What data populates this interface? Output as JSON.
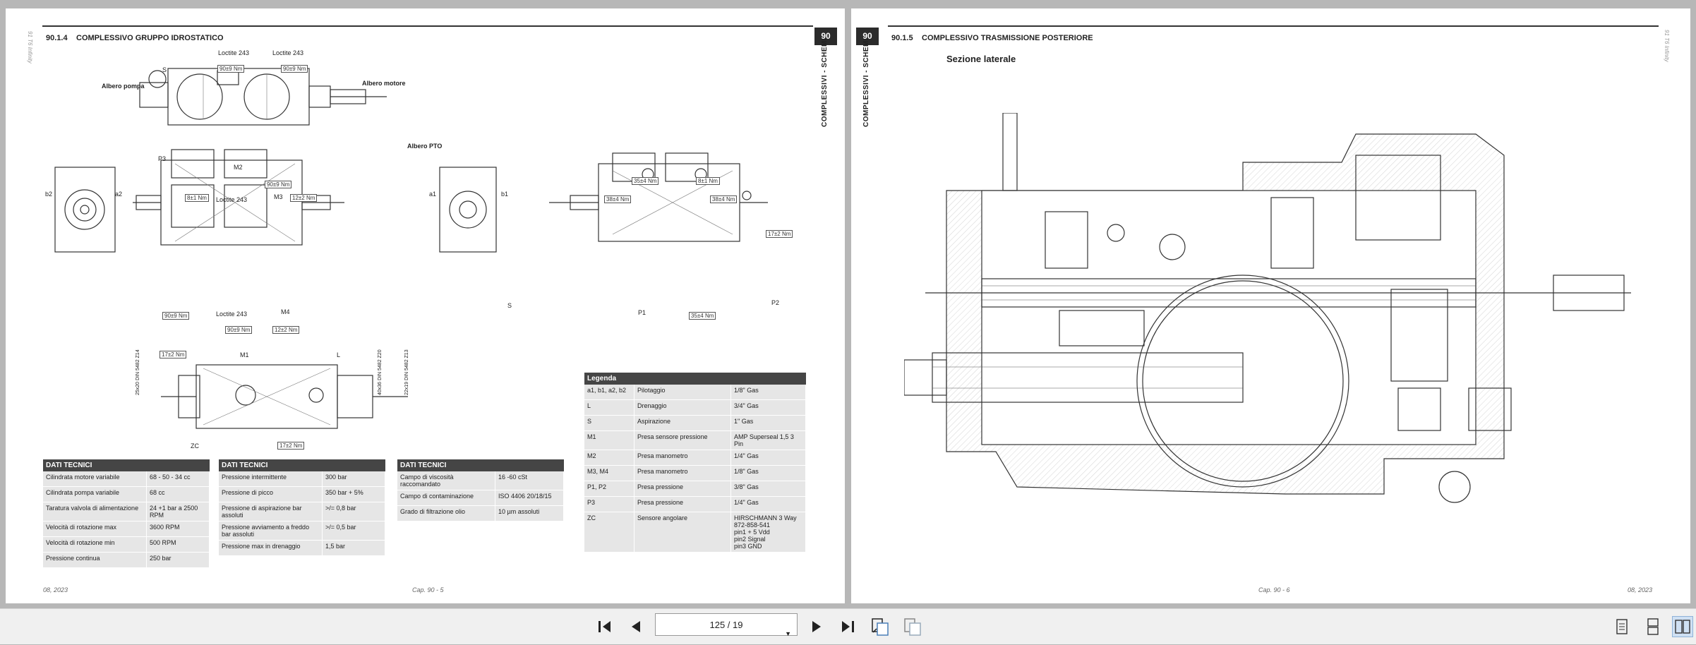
{
  "left_page": {
    "section_number": "90.1.4",
    "section_title": "COMPLESSIVO GRUPPO IDROSTATICO",
    "chapter_badge": "90",
    "side_label": "COMPLESSIVI - SCHEMI",
    "brand": "91 T6 Infinity",
    "footer_date": "08, 2023",
    "footer_page": "Cap. 90 - 5",
    "drawing_labels": {
      "albero_pompa": "Albero pompa",
      "albero_motore": "Albero motore",
      "albero_pto": "Albero PTO",
      "loctite1": "Loctite 243",
      "loctite2": "Loctite 243",
      "loctite3": "Loctite 243",
      "loctite4": "Loctite 243",
      "s1": "S",
      "s2": "S",
      "p3": "P3",
      "m2": "M2",
      "m3": "M3",
      "m4": "M4",
      "m1": "M1",
      "b2": "b2",
      "a2": "a2",
      "a1": "a1",
      "b1": "b1",
      "p1": "P1",
      "p2": "P2",
      "l": "L",
      "zc": "ZC",
      "t_90_9_a": "90±9  Nm",
      "t_90_9_b": "90±9  Nm",
      "t_90_9_c": "90±9  Nm",
      "t_90_9_d": "90±9  Nm",
      "t_90_9_e": "90±9  Nm",
      "t_8_1": "8±1  Nm",
      "t_12_2_a": "12±2  Nm",
      "t_12_2_b": "12±2  Nm",
      "t_35_4_a": "35±4  Nm",
      "t_35_4_b": "35±4  Nm",
      "t_38_4_a": "38±4  Nm",
      "t_38_4_b": "38±4  Nm",
      "t_8_1_b": "8±1  Nm",
      "t_17_2_a": "17±2  Nm",
      "t_17_2_b": "17±2  Nm",
      "t_17_2_c": "17±2  Nm",
      "dim1": "25x20 DIN 5482 Z14",
      "dim2": "40x36 DIN 5482 Z20",
      "dim3": "22x19 DIN 5482 Z13"
    },
    "table1": {
      "header": "DATI TECNICI",
      "rows": [
        [
          "Cilindrata motore variabile",
          "68 - 50 - 34  cc"
        ],
        [
          "Cilindrata pompa variabile",
          "68 cc"
        ],
        [
          "Taratura valvola di alimentazione",
          "24 +1 bar a 2500 RPM"
        ],
        [
          "Velocità di rotazione max",
          "3600 RPM"
        ],
        [
          "Velocità di rotazione min",
          "500 RPM"
        ],
        [
          "Pressione continua",
          "250 bar"
        ]
      ]
    },
    "table2": {
      "header": "DATI TECNICI",
      "rows": [
        [
          "Pressione intermittente",
          "300 bar"
        ],
        [
          "Pressione di picco",
          "350 bar + 5%"
        ],
        [
          "Pressione di aspirazione bar assoluti",
          ">/= 0,8 bar"
        ],
        [
          "Pressione avviamento a freddo bar assoluti",
          ">/= 0,5 bar"
        ],
        [
          "Pressione max in drenaggio",
          "1,5 bar"
        ]
      ]
    },
    "table3": {
      "header": "DATI TECNICI",
      "rows": [
        [
          "Campo di viscosità raccomandato",
          "16 -60 cSt"
        ],
        [
          "Campo di contaminazione",
          "ISO 4406 20/18/15"
        ],
        [
          "Grado di filtrazione olio",
          "10 µm assoluti"
        ]
      ]
    },
    "legend": {
      "header": "Legenda",
      "rows": [
        [
          "a1, b1, a2, b2",
          "Pilotaggio",
          "1/8\" Gas"
        ],
        [
          "L",
          "Drenaggio",
          "3/4\" Gas"
        ],
        [
          "S",
          "Aspirazione",
          "1\" Gas"
        ],
        [
          "M1",
          "Presa sensore pressione",
          "AMP Superseal 1,5 3 Pin"
        ],
        [
          "M2",
          "Presa manometro",
          "1/4\" Gas"
        ],
        [
          "M3, M4",
          "Presa manometro",
          "1/8\" Gas"
        ],
        [
          "P1, P2",
          "Presa pressione",
          "3/8\" Gas"
        ],
        [
          "P3",
          "Presa pressione",
          "1/4\" Gas"
        ],
        [
          "ZC",
          "Sensore angolare",
          "HIRSCHMANN 3 Way\n872-858-541\npin1 + 5 Vdd\npin2 Signal\npin3 GND"
        ]
      ]
    }
  },
  "right_page": {
    "section_number": "90.1.5",
    "section_title": "COMPLESSIVO TRASMISSIONE POSTERIORE",
    "chapter_badge": "90",
    "side_label": "COMPLESSIVI - SCHEMI",
    "brand": "91 T6 Infinity",
    "subtitle": "Sezione laterale",
    "footer_date": "08, 2023",
    "footer_page": "Cap. 90 - 6"
  },
  "toolbar": {
    "page_indicator": "125 / 19",
    "icons": [
      "first-page-icon",
      "prev-page-icon",
      "next-page-icon",
      "last-page-icon",
      "fit-page-icon",
      "fit-width-icon",
      "single-page-view-icon",
      "continuous-view-icon",
      "two-page-view-icon"
    ]
  },
  "colors": {
    "viewer_bg": "#b7b7b7",
    "table_header": "#454545",
    "table_cell": "#e6e6e6",
    "toolbar_bg": "#f0f0f0"
  }
}
